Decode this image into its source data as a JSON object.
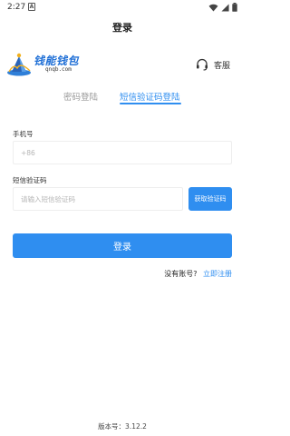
{
  "status_bar": {
    "time": "2:27",
    "notification_badge": "A",
    "icons": [
      "wifi-icon",
      "signal-icon",
      "battery-icon"
    ]
  },
  "header": {
    "title": "登录"
  },
  "logo": {
    "title": "钱能钱包",
    "subtitle": "qnqb.com"
  },
  "service": {
    "label": "客服",
    "icon": "headset-icon"
  },
  "tabs": [
    {
      "label": "密码登陆",
      "active": false
    },
    {
      "label": "短信验证码登陆",
      "active": true
    }
  ],
  "form": {
    "phone_label": "手机号",
    "phone_placeholder": "+86",
    "code_label": "短信验证码",
    "code_placeholder": "请输入短信验证码",
    "get_code_label": "获取验证码",
    "login_label": "登录"
  },
  "register": {
    "question": "没有账号?",
    "link": "立即注册"
  },
  "footer": {
    "version": "版本号：3.12.2"
  },
  "colors": {
    "accent": "#2f8ef0",
    "logo_blue": "#1f6fd6"
  }
}
